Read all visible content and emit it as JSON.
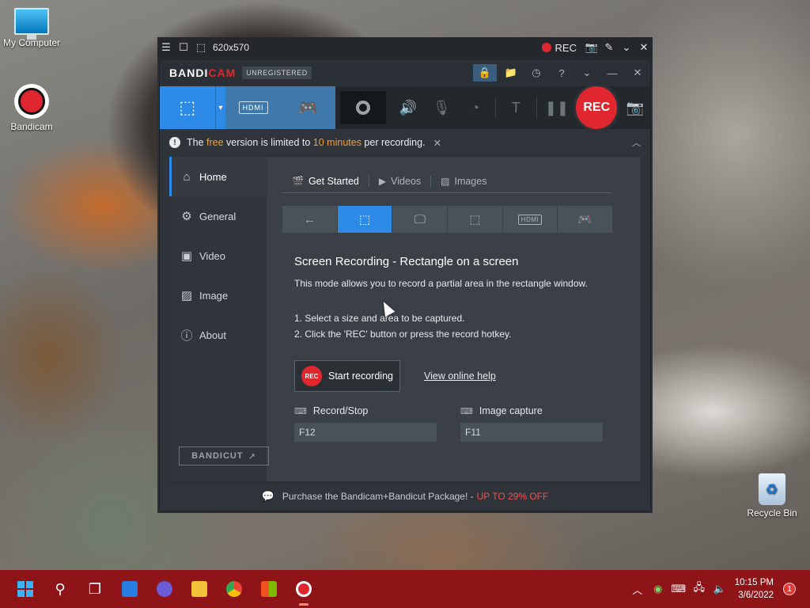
{
  "desktop": {
    "icons": [
      {
        "label": "My Computer"
      },
      {
        "label": "Bandicam"
      },
      {
        "label": "Recycle Bin"
      }
    ]
  },
  "capture_bar": {
    "size": "620x570",
    "rec_label": "REC"
  },
  "window": {
    "brand_main": "BANDI",
    "brand_accent": "CAM",
    "unregistered": "UNREGISTERED",
    "toolbar": {
      "hdmi_label": "HDMI",
      "rec_label": "REC"
    },
    "notice": {
      "prefix": "The ",
      "free": "free",
      "middle": " version is limited to ",
      "limit": "10 minutes",
      "suffix": " per recording."
    },
    "sidebar": {
      "items": [
        {
          "label": "Home"
        },
        {
          "label": "General"
        },
        {
          "label": "Video"
        },
        {
          "label": "Image"
        },
        {
          "label": "About"
        }
      ],
      "bandicut_label": "BANDICUT"
    },
    "tabs": [
      {
        "label": "Get Started"
      },
      {
        "label": "Videos"
      },
      {
        "label": "Images"
      }
    ],
    "submode_hdmi": "HDMI",
    "content": {
      "heading": "Screen Recording - Rectangle on a screen",
      "description": "This mode allows you to record a partial area in the rectangle window.",
      "step1": "1. Select a size and area to be captured.",
      "step2": "2. Click the 'REC' button or press the record hotkey.",
      "start_badge": "REC",
      "start_label": "Start recording",
      "help_link": "View online help",
      "hotkeys": [
        {
          "label": "Record/Stop",
          "value": "F12"
        },
        {
          "label": "Image capture",
          "value": "F11"
        }
      ]
    },
    "promo": {
      "text": "Purchase the Bandicam+Bandicut Package! - ",
      "discount": "UP TO 29% OFF"
    }
  },
  "taskbar": {
    "time": "10:15 PM",
    "date": "3/6/2022",
    "notification_count": "1"
  },
  "colors": {
    "accent": "#2d8ae6",
    "rec": "#e0262e",
    "taskbar": "#8e1418",
    "highlight": "#f0a032"
  }
}
